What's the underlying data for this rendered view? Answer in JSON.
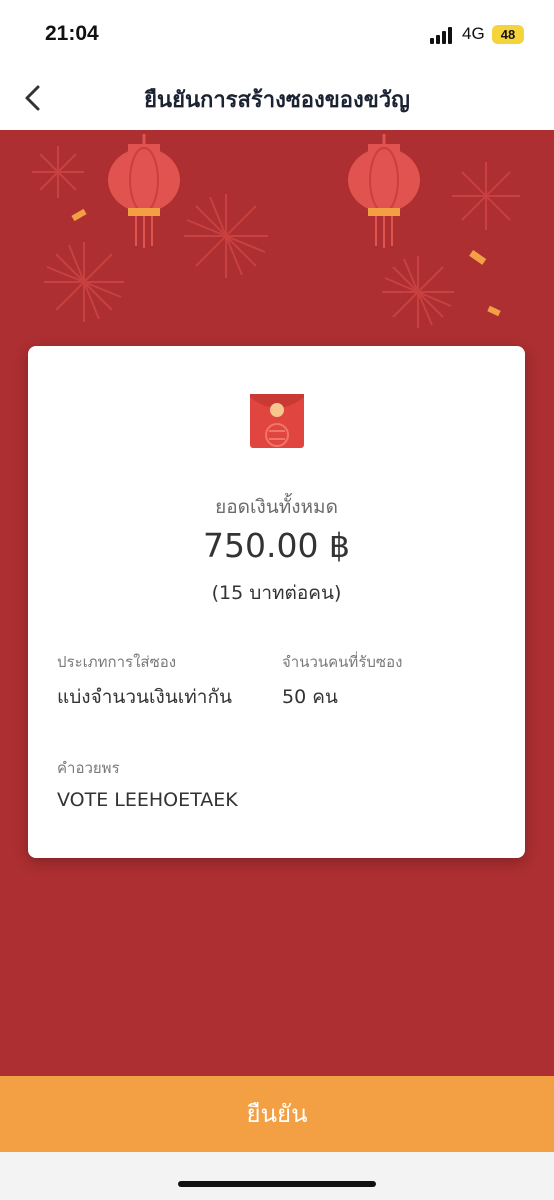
{
  "status_bar": {
    "time": "21:04",
    "network": "4G",
    "battery": "48",
    "battery_color": "#f5d33b"
  },
  "nav": {
    "title": "ยืนยันการสร้างซองของขวัญ",
    "back_icon": "chevron-left-icon"
  },
  "theme": {
    "background_red": "#ad2f31",
    "confirm_orange": "#f3a045"
  },
  "card": {
    "total_label": "ยอดเงินทั้งหมด",
    "total_amount": "750.00 ฿",
    "per_person": "(15 บาทต่อคน)",
    "envelope_type_label": "ประเภทการใส่ซอง",
    "envelope_type_value": "แบ่งจำนวนเงินเท่ากัน",
    "recipients_label": "จำนวนคนที่รับซอง",
    "recipients_value": "50 คน",
    "blessing_label": "คำอวยพร",
    "blessing_value": "VOTE LEEHOETAEK"
  },
  "footer": {
    "confirm_label": "ยืนยัน"
  }
}
